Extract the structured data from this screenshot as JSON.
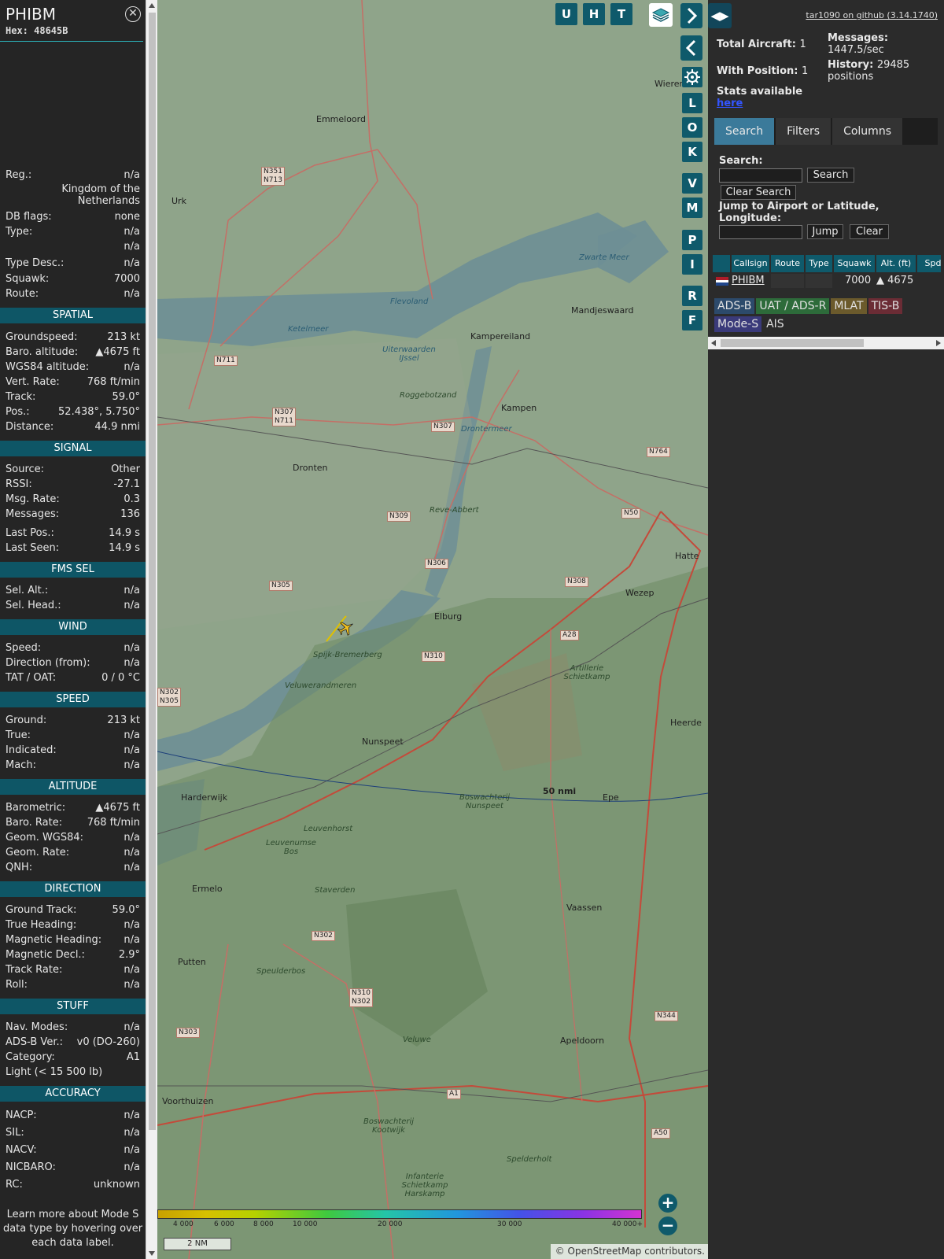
{
  "aircraft": {
    "callsign": "PHIBM",
    "hex": "Hex: 48645B"
  },
  "info": {
    "basic": [
      {
        "label": "Reg.:",
        "value": "n/a"
      },
      {
        "label": "DB flags:",
        "value": "none"
      },
      {
        "label": "Type:",
        "value": "n/a"
      },
      {
        "label": "",
        "value": "n/a"
      },
      {
        "label": "Type Desc.:",
        "value": "n/a"
      },
      {
        "label": "Squawk:",
        "value": "7000"
      },
      {
        "label": "Route:",
        "value": "n/a"
      }
    ],
    "country": "Kingdom of the Netherlands",
    "spatial_title": "SPATIAL",
    "spatial": [
      {
        "label": "Groundspeed:",
        "value": "213 kt"
      },
      {
        "label": "Baro. altitude:",
        "value": "▲4675 ft"
      },
      {
        "label": "WGS84 altitude:",
        "value": "n/a"
      },
      {
        "label": "Vert. Rate:",
        "value": "768 ft/min"
      },
      {
        "label": "Track:",
        "value": "59.0°"
      },
      {
        "label": "Pos.:",
        "value": "52.438°, 5.750°"
      },
      {
        "label": "Distance:",
        "value": "44.9 nmi"
      }
    ],
    "signal_title": "SIGNAL",
    "signal": [
      {
        "label": "Source:",
        "value": "Other"
      },
      {
        "label": "RSSI:",
        "value": "-27.1"
      },
      {
        "label": "Msg. Rate:",
        "value": "0.3"
      },
      {
        "label": "Messages:",
        "value": "136"
      },
      {
        "label": "Last Pos.:",
        "value": "14.9 s"
      },
      {
        "label": "Last Seen:",
        "value": "14.9 s"
      }
    ],
    "fms_title": "FMS SEL",
    "fms": [
      {
        "label": "Sel. Alt.:",
        "value": "n/a"
      },
      {
        "label": "Sel. Head.:",
        "value": "n/a"
      }
    ],
    "wind_title": "WIND",
    "wind": [
      {
        "label": "Speed:",
        "value": "n/a"
      },
      {
        "label": "Direction (from):",
        "value": "n/a"
      },
      {
        "label": "TAT / OAT:",
        "value": "0 / 0 °C"
      }
    ],
    "speed_title": "SPEED",
    "speed": [
      {
        "label": "Ground:",
        "value": "213 kt"
      },
      {
        "label": "True:",
        "value": "n/a"
      },
      {
        "label": "Indicated:",
        "value": "n/a"
      },
      {
        "label": "Mach:",
        "value": "n/a"
      }
    ],
    "altitude_title": "ALTITUDE",
    "altitude": [
      {
        "label": "Barometric:",
        "value": "▲4675 ft"
      },
      {
        "label": "Baro. Rate:",
        "value": "768 ft/min"
      },
      {
        "label": "Geom. WGS84:",
        "value": "n/a"
      },
      {
        "label": "Geom. Rate:",
        "value": "n/a"
      },
      {
        "label": "QNH:",
        "value": "n/a"
      }
    ],
    "direction_title": "DIRECTION",
    "direction": [
      {
        "label": "Ground Track:",
        "value": "59.0°"
      },
      {
        "label": "True Heading:",
        "value": "n/a"
      },
      {
        "label": "Magnetic Heading:",
        "value": "n/a"
      },
      {
        "label": "Magnetic Decl.:",
        "value": "2.9°"
      },
      {
        "label": "Track Rate:",
        "value": "n/a"
      },
      {
        "label": "Roll:",
        "value": "n/a"
      }
    ],
    "stuff_title": "STUFF",
    "stuff": [
      {
        "label": "Nav. Modes:",
        "value": "n/a"
      },
      {
        "label": "ADS-B Ver.:",
        "value": "v0 (DO-260)"
      },
      {
        "label": "Category:",
        "value": "A1"
      },
      {
        "label": "Light (< 15 500 lb)",
        "value": ""
      }
    ],
    "accuracy_title": "ACCURACY",
    "accuracy": [
      {
        "label": "NACP:",
        "value": "n/a"
      },
      {
        "label": "SIL:",
        "value": "n/a"
      },
      {
        "label": "NACV:",
        "value": "n/a"
      },
      {
        "label": "NICBARO:",
        "value": "n/a"
      },
      {
        "label": "RC:",
        "value": "unknown"
      }
    ],
    "footer": "Learn more about Mode S data type by hovering over each data label."
  },
  "map": {
    "buttons_top": [
      "U",
      "H",
      "T"
    ],
    "buttons_side": [
      "L",
      "O",
      "K",
      "V",
      "M",
      "P",
      "I",
      "R",
      "F"
    ],
    "places": [
      {
        "name": "Emmeloord"
      },
      {
        "name": "Urk"
      },
      {
        "name": "Kampereiland"
      },
      {
        "name": "Kampen"
      },
      {
        "name": "Dronten"
      },
      {
        "name": "Elburg"
      },
      {
        "name": "Wezep"
      },
      {
        "name": "Nunspeet"
      },
      {
        "name": "Harderwijk"
      },
      {
        "name": "Epe"
      },
      {
        "name": "Heerde"
      },
      {
        "name": "Ermelo"
      },
      {
        "name": "Vaassen"
      },
      {
        "name": "Putten"
      },
      {
        "name": "Apeldoorn"
      },
      {
        "name": "Voorthuizen"
      },
      {
        "name": "Mandjeswaard"
      },
      {
        "name": "Hatte"
      },
      {
        "name": "Wierer"
      }
    ],
    "areas": [
      {
        "name": "Ketelmeer"
      },
      {
        "name": "Uiterwaarden IJssel"
      },
      {
        "name": "Roggebotzand"
      },
      {
        "name": "Reve-Abbert"
      },
      {
        "name": "Spijk-Bremerberg"
      },
      {
        "name": "Veluwerandmeren"
      },
      {
        "name": "Artillerie Schietkamp"
      },
      {
        "name": "Boswachterij Nunspeet"
      },
      {
        "name": "Leuvenhorst"
      },
      {
        "name": "Leuvenumse Bos"
      },
      {
        "name": "Staverden"
      },
      {
        "name": "Speulderbos"
      },
      {
        "name": "Veluwe"
      },
      {
        "name": "Boswachterij Kootwijk"
      },
      {
        "name": "Infanterie Schietkamp Harskamp"
      },
      {
        "name": "Spelderholt"
      },
      {
        "name": "Zwarte Meer"
      },
      {
        "name": "Flevoland"
      },
      {
        "name": "Drontermeer"
      }
    ],
    "roads": [
      "N351 N713",
      "N711",
      "N307 N711",
      "N307",
      "N764",
      "N50",
      "N309",
      "N306",
      "N305",
      "N308",
      "A28",
      "N310",
      "N302 N305",
      "N302",
      "N310 N302",
      "N303",
      "N344",
      "A1",
      "A50"
    ],
    "range_ring_label": "50 nmi",
    "legend_ticks": [
      "4 000",
      "6 000",
      "8 000",
      "10 000",
      "20 000",
      "30 000",
      "40 000+"
    ],
    "scale": "2 NM",
    "attribution": "© OpenStreetMap contributors.",
    "aircraft_track_deg": 59.0
  },
  "right": {
    "github": "tar1090 on github (3.14.1740)",
    "total_aircraft_label": "Total Aircraft:",
    "total_aircraft": "1",
    "with_position_label": "With Position:",
    "with_position": "1",
    "messages_label": "Messages:",
    "messages": "1447.5/sec",
    "history_label": "History:",
    "history": "29485 positions",
    "stats_text": "Stats available",
    "stats_link": "here",
    "tabs": [
      "Search",
      "Filters",
      "Columns"
    ],
    "search_label": "Search:",
    "search_btn": "Search",
    "clear_search_btn": "Clear Search",
    "jump_label": "Jump to Airport or Latitude, Longitude:",
    "jump_btn": "Jump",
    "clear_btn": "Clear",
    "columns": [
      "Callsign",
      "Route",
      "Type",
      "Squawk",
      "Alt. (ft)",
      "Spd"
    ],
    "row": {
      "callsign": "PHIBM",
      "route": "",
      "type": "",
      "squawk": "7000",
      "alt": "▲ 4675"
    },
    "sources": [
      {
        "label": "ADS-B",
        "color": "#2c4a6b"
      },
      {
        "label": "UAT / ADS-R",
        "color": "#2d6b3a"
      },
      {
        "label": "MLAT",
        "color": "#6b5a2c"
      },
      {
        "label": "TIS-B",
        "color": "#6b2c35"
      },
      {
        "label": "Mode-S",
        "color": "#3a3a7a"
      },
      {
        "label": "AIS",
        "color": "#2b2b2b"
      }
    ]
  }
}
